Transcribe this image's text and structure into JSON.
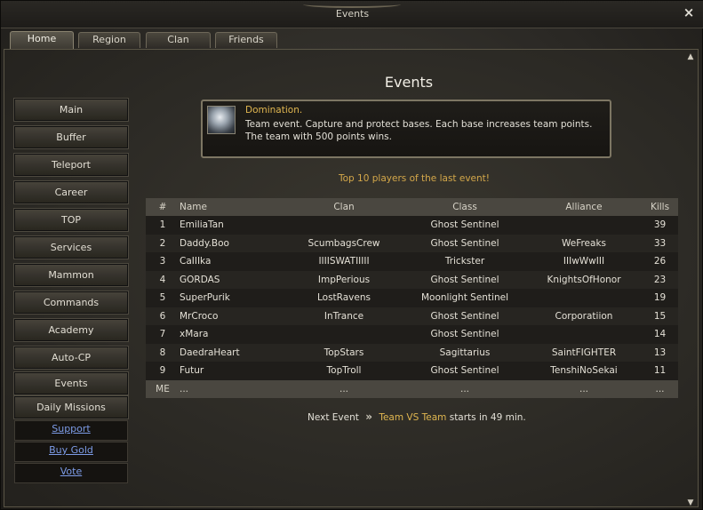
{
  "window": {
    "title": "Events",
    "close": "×"
  },
  "tabs": [
    "Home",
    "Region",
    "Clan",
    "Friends"
  ],
  "sidebar": {
    "buttons": [
      "Main",
      "Buffer",
      "Teleport",
      "Career",
      "TOP",
      "Services",
      "Mammon",
      "Commands",
      "Academy",
      "Auto-CP",
      "Events",
      "Daily Missions"
    ],
    "links": [
      "Support",
      "Buy Gold",
      "Vote"
    ]
  },
  "main": {
    "heading": "Events",
    "event": {
      "name": "Domination.",
      "description": "Team event. Capture and protect bases. Each base increases team points. The team with 500 points wins."
    },
    "subtitle": "Top 10 players of the last event!",
    "table": {
      "headers": [
        "#",
        "Name",
        "Clan",
        "Class",
        "Alliance",
        "Kills"
      ],
      "rows": [
        [
          "1",
          "EmiliaTan",
          "",
          "Ghost Sentinel",
          "",
          "39"
        ],
        [
          "2",
          "Daddy.Boo",
          "ScumbagsCrew",
          "Ghost Sentinel",
          "WeFreaks",
          "33"
        ],
        [
          "3",
          "CaIIIka",
          "IIIISWATIIIII",
          "Trickster",
          "IIIwWwIII",
          "26"
        ],
        [
          "4",
          "GORDAS",
          "ImpPerious",
          "Ghost Sentinel",
          "KnightsOfHonor",
          "23"
        ],
        [
          "5",
          "SuperPurik",
          "LostRavens",
          "Moonlight Sentinel",
          "",
          "19"
        ],
        [
          "6",
          "MrCroco",
          "InTrance",
          "Ghost Sentinel",
          "Corporatiion",
          "15"
        ],
        [
          "7",
          "xMara",
          "",
          "Ghost Sentinel",
          "",
          "14"
        ],
        [
          "8",
          "DaedraHeart",
          "TopStars",
          "Sagittarius",
          "SaintFIGHTER",
          "13"
        ],
        [
          "9",
          "Futur",
          "TopTroll",
          "Ghost Sentinel",
          "TenshiNoSekai",
          "11"
        ]
      ],
      "me_row": [
        "ME",
        "...",
        "...",
        "...",
        "...",
        "..."
      ]
    },
    "next_event": {
      "label": "Next Event",
      "arrow": "»",
      "event_name": "Team VS Team",
      "suffix": "starts in 49 min."
    }
  }
}
